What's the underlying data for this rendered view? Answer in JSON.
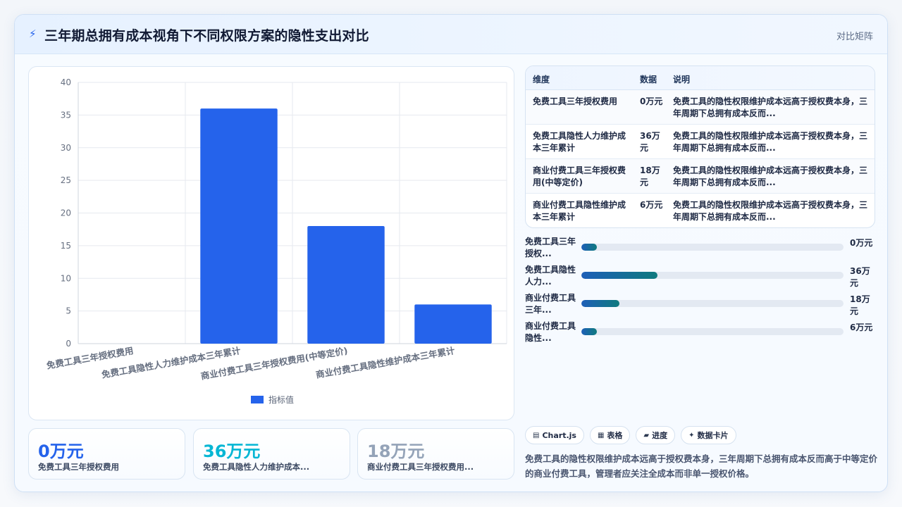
{
  "header": {
    "title": "三年期总拥有成本视角下不同权限方案的隐性支出对比",
    "tag": "对比矩阵"
  },
  "chart_data": {
    "type": "bar",
    "categories": [
      "免费工具三年授权费用",
      "免费工具隐性人力维护成本三年累计",
      "商业付费工具三年授权费用(中等定价)",
      "商业付费工具隐性维护成本三年累计"
    ],
    "series": [
      {
        "name": "指标值",
        "values": [
          0,
          36,
          18,
          6
        ]
      }
    ],
    "ylim": [
      0,
      40
    ],
    "yticks": [
      0,
      5,
      10,
      15,
      20,
      25,
      30,
      35,
      40
    ],
    "grid": true,
    "legend": "bottom",
    "bar_color": "#2563eb"
  },
  "table": {
    "headers": [
      "维度",
      "数据",
      "说明"
    ],
    "rows": [
      {
        "dim": "免费工具三年授权费用",
        "val": "0万元",
        "note": "免费工具的隐性权限维护成本远高于授权费本身，三年周期下总拥有成本反而..."
      },
      {
        "dim": "免费工具隐性人力维护成本三年累计",
        "val": "36万元",
        "note": "免费工具的隐性权限维护成本远高于授权费本身，三年周期下总拥有成本反而..."
      },
      {
        "dim": "商业付费工具三年授权费用(中等定价)",
        "val": "18万元",
        "note": "免费工具的隐性权限维护成本远高于授权费本身，三年周期下总拥有成本反而..."
      },
      {
        "dim": "商业付费工具隐性维护成本三年累计",
        "val": "6万元",
        "note": "免费工具的隐性权限维护成本远高于授权费本身，三年周期下总拥有成本反而..."
      }
    ]
  },
  "progress": [
    {
      "label": "免费工具三年授权...",
      "value_label": "0万元",
      "fraction": 0.06
    },
    {
      "label": "免费工具隐性人力...",
      "value_label": "36万元",
      "fraction": 0.29
    },
    {
      "label": "商业付费工具三年...",
      "value_label": "18万元",
      "fraction": 0.145
    },
    {
      "label": "商业付费工具隐性...",
      "value_label": "6万元",
      "fraction": 0.06
    }
  ],
  "chips": [
    {
      "icon": "▤",
      "label": "Chart.js",
      "icon_name": "chart-icon"
    },
    {
      "icon": "▦",
      "label": "表格",
      "icon_name": "table-icon"
    },
    {
      "icon": "▰",
      "label": "进度",
      "icon_name": "progress-icon"
    },
    {
      "icon": "✦",
      "label": "数据卡片",
      "icon_name": "sparkle-icon"
    }
  ],
  "summary": "免费工具的隐性权限维护成本远高于授权费本身，三年周期下总拥有成本反而高于中等定价的商业付费工具，管理者应关注全成本而非单一授权价格。",
  "kpis": [
    {
      "value": "0万元",
      "label": "免费工具三年授权费用",
      "color": "#2563eb"
    },
    {
      "value": "36万元",
      "label": "免费工具隐性人力维护成本...",
      "color": "#06b6d4"
    },
    {
      "value": "18万元",
      "label": "商业付费工具三年授权费用...",
      "color": "#94a3b8"
    }
  ]
}
